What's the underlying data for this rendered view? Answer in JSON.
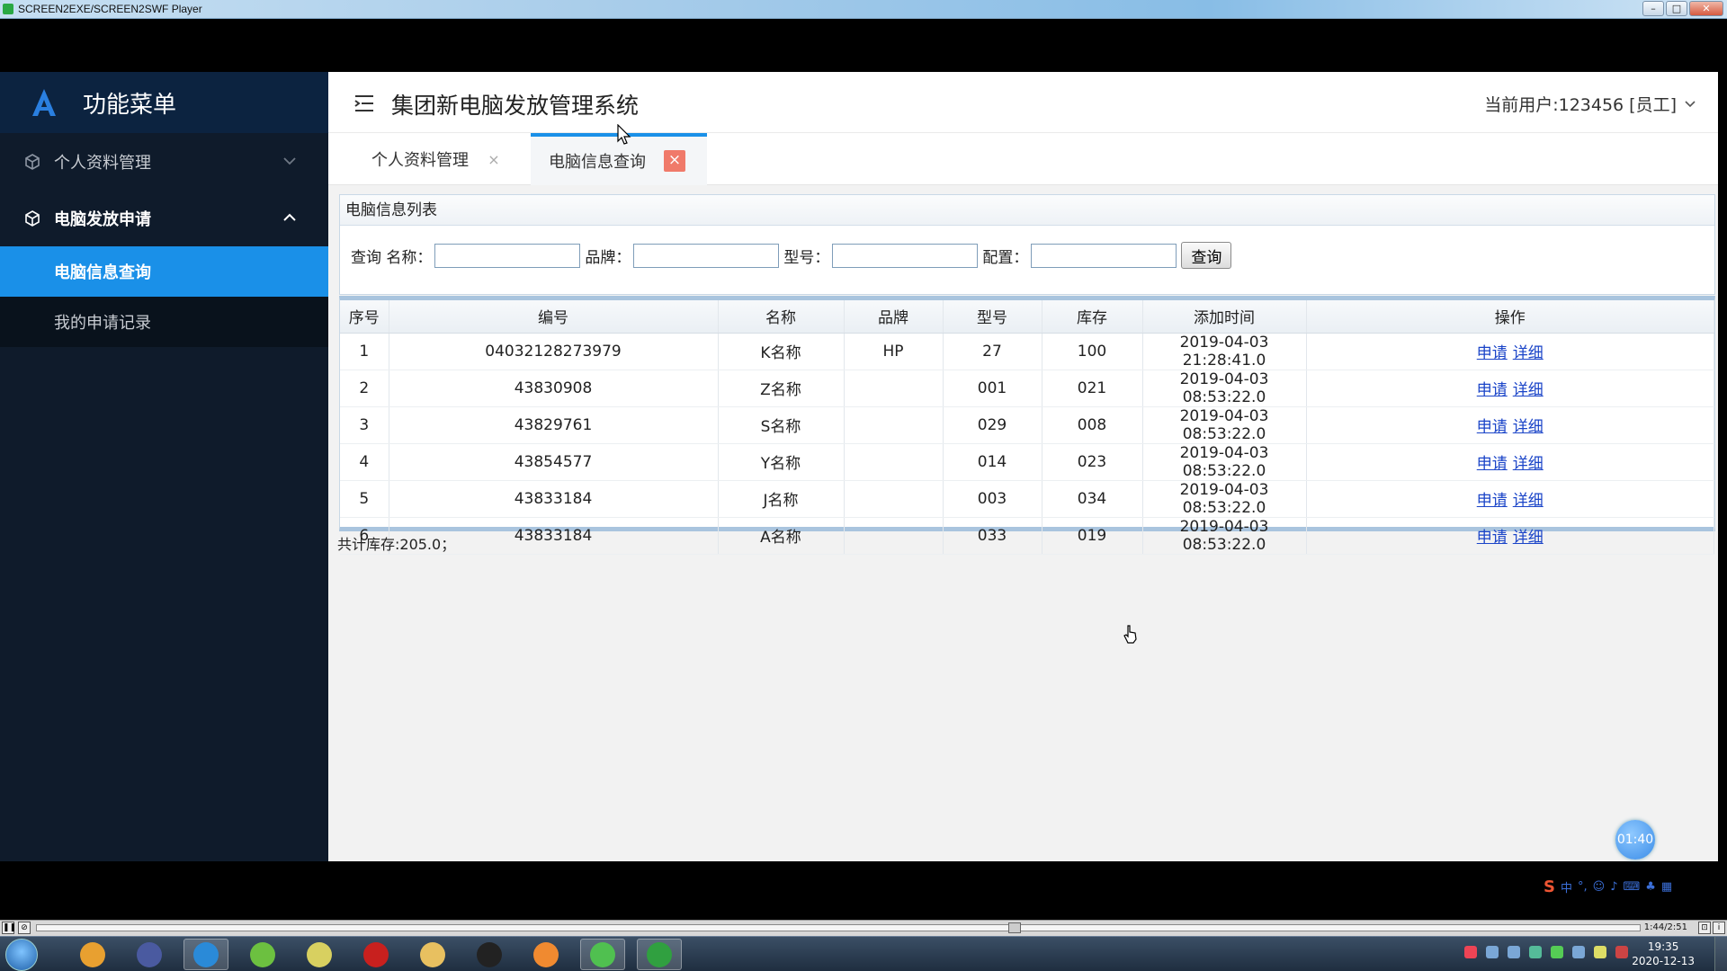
{
  "player": {
    "title": "SCREEN2EXE/SCREEN2SWF Player",
    "time_display": "1:44/2:51",
    "progress": 0.61
  },
  "sidebar": {
    "title": "功能菜单",
    "groups": [
      {
        "label": "个人资料管理",
        "expanded": false
      },
      {
        "label": "电脑发放申请",
        "expanded": true
      }
    ],
    "items": [
      {
        "label": "电脑信息查询",
        "active": true
      },
      {
        "label": "我的申请记录",
        "active": false
      }
    ]
  },
  "header": {
    "system_title": "集团新电脑发放管理系统",
    "current_user": "当前用户:123456 [员工]"
  },
  "tabs": [
    {
      "label": "个人资料管理",
      "close": "×"
    },
    {
      "label": "电脑信息查询",
      "close": "×"
    }
  ],
  "panel": {
    "title": "电脑信息列表",
    "query_prefix": "查询 名称：",
    "brand_label": "品牌：",
    "model_label": "型号：",
    "config_label": "配置：",
    "search_button": "查询",
    "name_value": "",
    "brand_value": "",
    "model_value": "",
    "config_value": ""
  },
  "table": {
    "columns": [
      "序号",
      "编号",
      "名称",
      "品牌",
      "型号",
      "库存",
      "添加时间",
      "操作"
    ],
    "rows": [
      [
        "1",
        "04032128273979",
        "K名称",
        "HP",
        "27",
        "100",
        "2019-04-03 21:28:41.0"
      ],
      [
        "2",
        "43830908",
        "Z名称",
        "",
        "001",
        "021",
        "2019-04-03 08:53:22.0"
      ],
      [
        "3",
        "43829761",
        "S名称",
        "",
        "029",
        "008",
        "2019-04-03 08:53:22.0"
      ],
      [
        "4",
        "43854577",
        "Y名称",
        "",
        "014",
        "023",
        "2019-04-03 08:53:22.0"
      ],
      [
        "5",
        "43833184",
        "J名称",
        "",
        "003",
        "034",
        "2019-04-03 08:53:22.0"
      ],
      [
        "6",
        "43833184",
        "A名称",
        "",
        "033",
        "019",
        "2019-04-03 08:53:22.0"
      ]
    ],
    "action_apply": "申请",
    "action_detail": "详细",
    "summary": "共计库存:205.0；"
  },
  "overlay": {
    "timer": "01:40"
  },
  "ime": {
    "label": "中"
  },
  "taskbar": {
    "clock_time": "19:35",
    "clock_date": "2020-12-13",
    "apps": [
      "chrome-icon",
      "eclipse-icon",
      "qq-browser-icon",
      "leaf-icon",
      "notepad-icon",
      "flash-icon",
      "folder-icon",
      "qq-icon",
      "audio-icon",
      "wechat-icon",
      "player-icon"
    ]
  },
  "colors": {
    "sidebar_bg": "#0f1b2b",
    "accent": "#1a90e8",
    "link": "#1a44c8",
    "tab_close": "#f07a6a"
  }
}
